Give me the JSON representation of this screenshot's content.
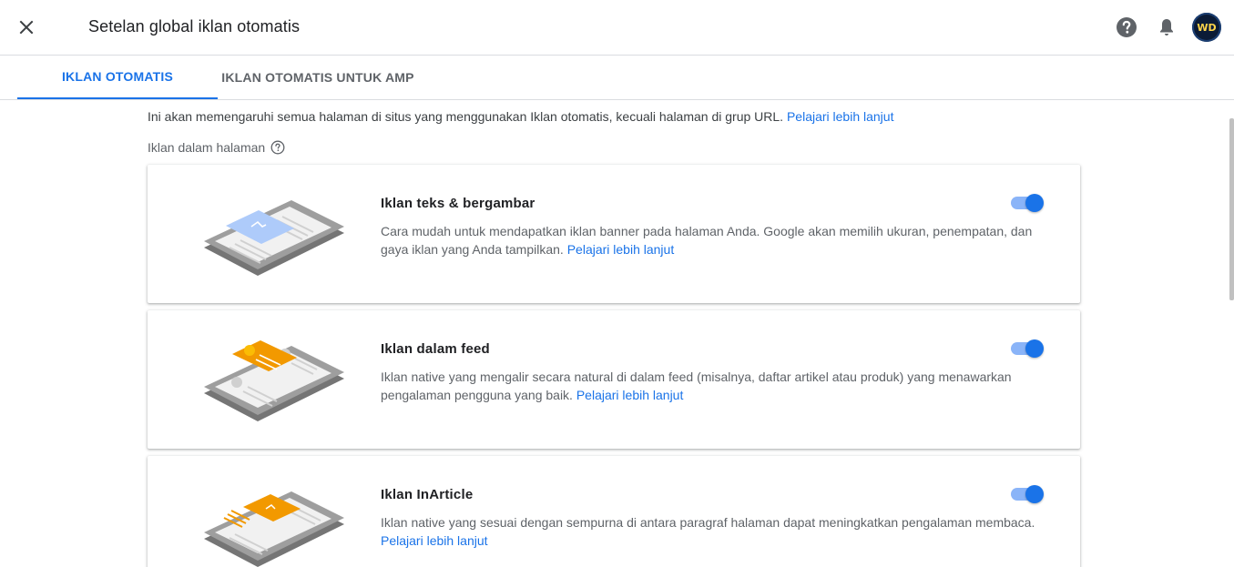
{
  "header": {
    "title": "Setelan global iklan otomatis",
    "close_icon": "close-icon",
    "help_icon": "help-icon",
    "notifications_icon": "bell-icon",
    "avatar_text": "WD"
  },
  "tabs": [
    {
      "label": "IKLAN OTOMATIS",
      "active": true
    },
    {
      "label": "IKLAN OTOMATIS UNTUK AMP",
      "active": false
    }
  ],
  "intro": {
    "text": "Ini akan memengaruhi semua halaman di situs yang menggunakan Iklan otomatis, kecuali halaman di grup URL.",
    "link": "Pelajari lebih lanjut"
  },
  "section_label": "Iklan dalam halaman",
  "cards": [
    {
      "title": "Iklan teks & bergambar",
      "desc": "Cara mudah untuk mendapatkan iklan banner pada halaman Anda. Google akan memilih ukuran, penempatan, dan gaya iklan yang Anda tampilkan.",
      "link": "Pelajari lebih lanjut",
      "enabled": true
    },
    {
      "title": "Iklan dalam feed",
      "desc": "Iklan native yang mengalir secara natural di dalam feed (misalnya, daftar artikel atau produk) yang menawarkan pengalaman pengguna yang baik.",
      "link": "Pelajari lebih lanjut",
      "enabled": true
    },
    {
      "title": "Iklan InArticle",
      "desc": "Iklan native yang sesuai dengan sempurna di antara paragraf halaman dapat meningkatkan pengalaman membaca.",
      "link": "Pelajari lebih lanjut",
      "enabled": true
    }
  ],
  "colors": {
    "accent": "#1a73e8",
    "toggle_track": "#8ab4f8",
    "ad_blue": "#aecbfa",
    "ad_orange": "#f29900"
  }
}
